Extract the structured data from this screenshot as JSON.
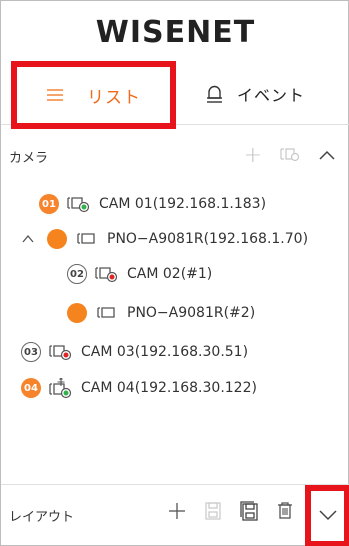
{
  "brand": {
    "logo_text": "WISENET"
  },
  "tabs": [
    {
      "label": "リスト",
      "icon": "list-icon",
      "active": true,
      "color": "#f26a1b"
    },
    {
      "label": "イベント",
      "icon": "bell-icon",
      "active": false
    }
  ],
  "camera_section": {
    "title": "カメラ",
    "actions": [
      "add-icon",
      "camera-settings-icon",
      "chevron-up-icon"
    ]
  },
  "devices": [
    {
      "badge": "01",
      "badge_style": "filled",
      "status_dot": "green",
      "label": "CAM 01(192.168.1.183)"
    },
    {
      "badge": "",
      "badge_style": "dot",
      "expandable": true,
      "label": "PNO−A9081R(192.168.1.70)"
    },
    {
      "badge": "02",
      "badge_style": "outline",
      "status_dot": "red",
      "label": "CAM 02(#1)",
      "indent": 1
    },
    {
      "badge": "",
      "badge_style": "dot",
      "label": "PNO−A9081R(#2)",
      "indent": 1
    },
    {
      "badge": "03",
      "badge_style": "outline",
      "status_dot": "red",
      "label": "CAM 03(192.168.30.51)"
    },
    {
      "badge": "04",
      "badge_style": "filled",
      "status_dot": "green-ptz",
      "label": "CAM 04(192.168.30.122)"
    }
  ],
  "layout_section": {
    "title": "レイアウト",
    "actions": [
      "add-icon",
      "save-icon",
      "save-as-icon",
      "delete-icon",
      "chevron-down-icon"
    ]
  },
  "colors": {
    "accent": "#f5842c",
    "highlight_box": "#e8141c",
    "online": "#2fb24a",
    "recording": "#e02424"
  }
}
